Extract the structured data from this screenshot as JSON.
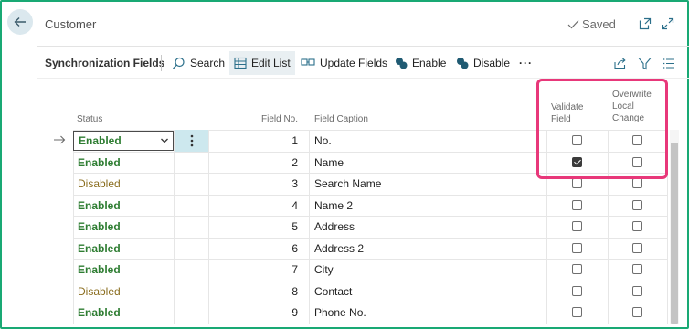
{
  "header": {
    "title": "Customer",
    "saved_label": "Saved",
    "back_icon": "arrow-left-icon",
    "open_new_icon": "open-in-new-window-icon",
    "expand_icon": "expand-icon"
  },
  "toolbar": {
    "title": "Synchronization Fields",
    "actions": [
      {
        "label": "Search",
        "icon": "search-icon"
      },
      {
        "label": "Edit List",
        "icon": "edit-list-icon"
      },
      {
        "label": "Update Fields",
        "icon": "update-fields-icon"
      },
      {
        "label": "Enable",
        "icon": "enable-icon"
      },
      {
        "label": "Disable",
        "icon": "disable-icon"
      }
    ],
    "more_label": "···",
    "share_icon": "share-icon",
    "filter_icon": "filter-icon",
    "list_icon": "list-icon"
  },
  "columns": {
    "status": "Status",
    "field_no": "Field No.",
    "field_caption": "Field Caption",
    "validate_field": [
      "Validate",
      "Field"
    ],
    "overwrite_local_change": [
      "Overwrite",
      "Local",
      "Change"
    ]
  },
  "rows": [
    {
      "status": "Enabled",
      "field_no": "1",
      "caption": "No.",
      "validate": false,
      "overwrite": false
    },
    {
      "status": "Enabled",
      "field_no": "2",
      "caption": "Name",
      "validate": true,
      "overwrite": false
    },
    {
      "status": "Disabled",
      "field_no": "3",
      "caption": "Search Name",
      "validate": false,
      "overwrite": false
    },
    {
      "status": "Enabled",
      "field_no": "4",
      "caption": "Name 2",
      "validate": false,
      "overwrite": false
    },
    {
      "status": "Enabled",
      "field_no": "5",
      "caption": "Address",
      "validate": false,
      "overwrite": false
    },
    {
      "status": "Enabled",
      "field_no": "6",
      "caption": "Address 2",
      "validate": false,
      "overwrite": false
    },
    {
      "status": "Enabled",
      "field_no": "7",
      "caption": "City",
      "validate": false,
      "overwrite": false
    },
    {
      "status": "Disabled",
      "field_no": "8",
      "caption": "Contact",
      "validate": false,
      "overwrite": false
    },
    {
      "status": "Enabled",
      "field_no": "9",
      "caption": "Phone No.",
      "validate": false,
      "overwrite": false
    }
  ],
  "colors": {
    "frame": "#19a974",
    "enabled": "#2e7d32",
    "disabled": "#8a6d1e",
    "highlight": "#e8387a",
    "selected_cell": "#cde8ee"
  }
}
